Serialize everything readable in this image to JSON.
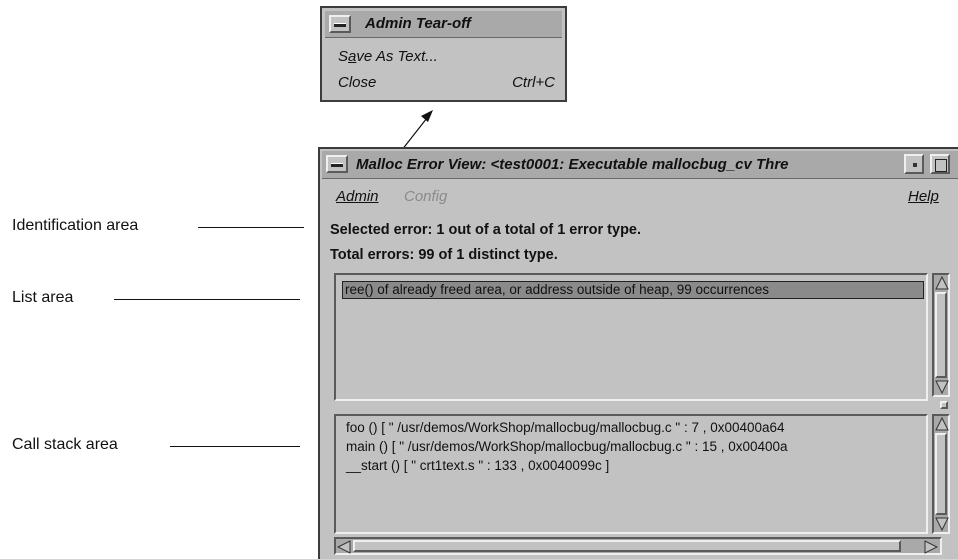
{
  "callouts": {
    "identification": "Identification area",
    "list": "List area",
    "callstack": "Call stack area"
  },
  "tearoff": {
    "title": "Admin Tear-off",
    "items": [
      {
        "label_pre": "S",
        "label_mnemonic": "a",
        "label_post": "ve As Text...",
        "accel": ""
      },
      {
        "label_pre": "",
        "label_mnemonic": "",
        "label_post": "Close",
        "accel": "Ctrl+C"
      }
    ]
  },
  "window": {
    "title": "Malloc Error View: <test0001: Executable mallocbug_cv Thre",
    "menus": {
      "admin": "Admin",
      "config": "Config",
      "help": "Help"
    },
    "identification": {
      "selected": "Selected error: 1 out of a total of 1 error type.",
      "total": "Total errors: 99 of 1 distinct type."
    },
    "list": {
      "rows": [
        "ree() of already freed area, or address outside of heap, 99 occurrences"
      ]
    },
    "callstack": {
      "lines": [
        "foo () [ \" /usr/demos/WorkShop/mallocbug/mallocbug.c \" : 7 , 0x00400a64",
        "main () [ \" /usr/demos/WorkShop/mallocbug/mallocbug.c \" : 15 , 0x00400a",
        "__start () [ \" crt1text.s \" : 133 , 0x0040099c ]"
      ]
    }
  },
  "colors": {
    "background": "#c2c2c2",
    "titlebar": "#a9a9a9",
    "selection": "#8a8a8a"
  }
}
